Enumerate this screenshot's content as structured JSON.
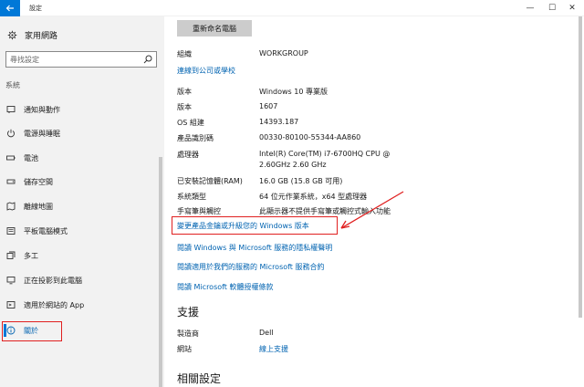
{
  "window": {
    "title": "設定",
    "minimize": "—",
    "maximize": "☐",
    "close": "✕"
  },
  "sidebar": {
    "home_label": "家用網路",
    "search_placeholder": "尋找設定",
    "section": "系統",
    "items": [
      {
        "label": "通知與動作",
        "icon": "notification-icon"
      },
      {
        "label": "電源與睡眠",
        "icon": "power-icon"
      },
      {
        "label": "電池",
        "icon": "battery-icon"
      },
      {
        "label": "儲存空間",
        "icon": "storage-icon"
      },
      {
        "label": "離線地圖",
        "icon": "map-icon"
      },
      {
        "label": "平板電腦模式",
        "icon": "tablet-icon"
      },
      {
        "label": "多工",
        "icon": "multitask-icon"
      },
      {
        "label": "正在投影到此電腦",
        "icon": "projecting-icon"
      },
      {
        "label": "適用於網站的 App",
        "icon": "apps-for-websites-icon"
      },
      {
        "label": "關於",
        "icon": "info-icon",
        "active": true
      }
    ]
  },
  "main": {
    "rename_button": "重新命名電腦",
    "org_label": "組織",
    "org_value": "WORKGROUP",
    "connect_link": "連線到公司或學校",
    "specs": [
      {
        "label": "版本",
        "value": "Windows 10 專業版"
      },
      {
        "label": "版本",
        "value": "1607"
      },
      {
        "label": "OS 組建",
        "value": "14393.187"
      },
      {
        "label": "產品識別碼",
        "value": "00330-80100-55344-AA860"
      },
      {
        "label": "處理器",
        "value": "Intel(R) Core(TM) i7-6700HQ CPU @",
        "value2": "2.60GHz   2.60 GHz"
      },
      {
        "label": "已安裝記憶體(RAM)",
        "value": "16.0 GB (15.8 GB 可用)"
      },
      {
        "label": "系統類型",
        "value": "64 位元作業系統，x64 型處理器"
      },
      {
        "label": "手寫筆與觸控",
        "value": "此顯示器不提供手寫筆或觸控式輸入功能"
      }
    ],
    "links": [
      "變更產品金鑰或升級您的 Windows 版本",
      "閱讀 Windows 與 Microsoft 服務的隱私權聲明",
      "閱讀適用於我們的服務的 Microsoft 服務合約",
      "閱讀 Microsoft 軟體授權條款"
    ],
    "support_title": "支援",
    "support": [
      {
        "label": "製造商",
        "value": "Dell"
      },
      {
        "label": "網站",
        "value": "線上支援"
      }
    ],
    "related_title": "相關設定"
  },
  "colors": {
    "accent": "#0078d7",
    "link": "#0063b1",
    "annotation": "#e02020",
    "sidebar_bg": "#f2f2f2"
  }
}
